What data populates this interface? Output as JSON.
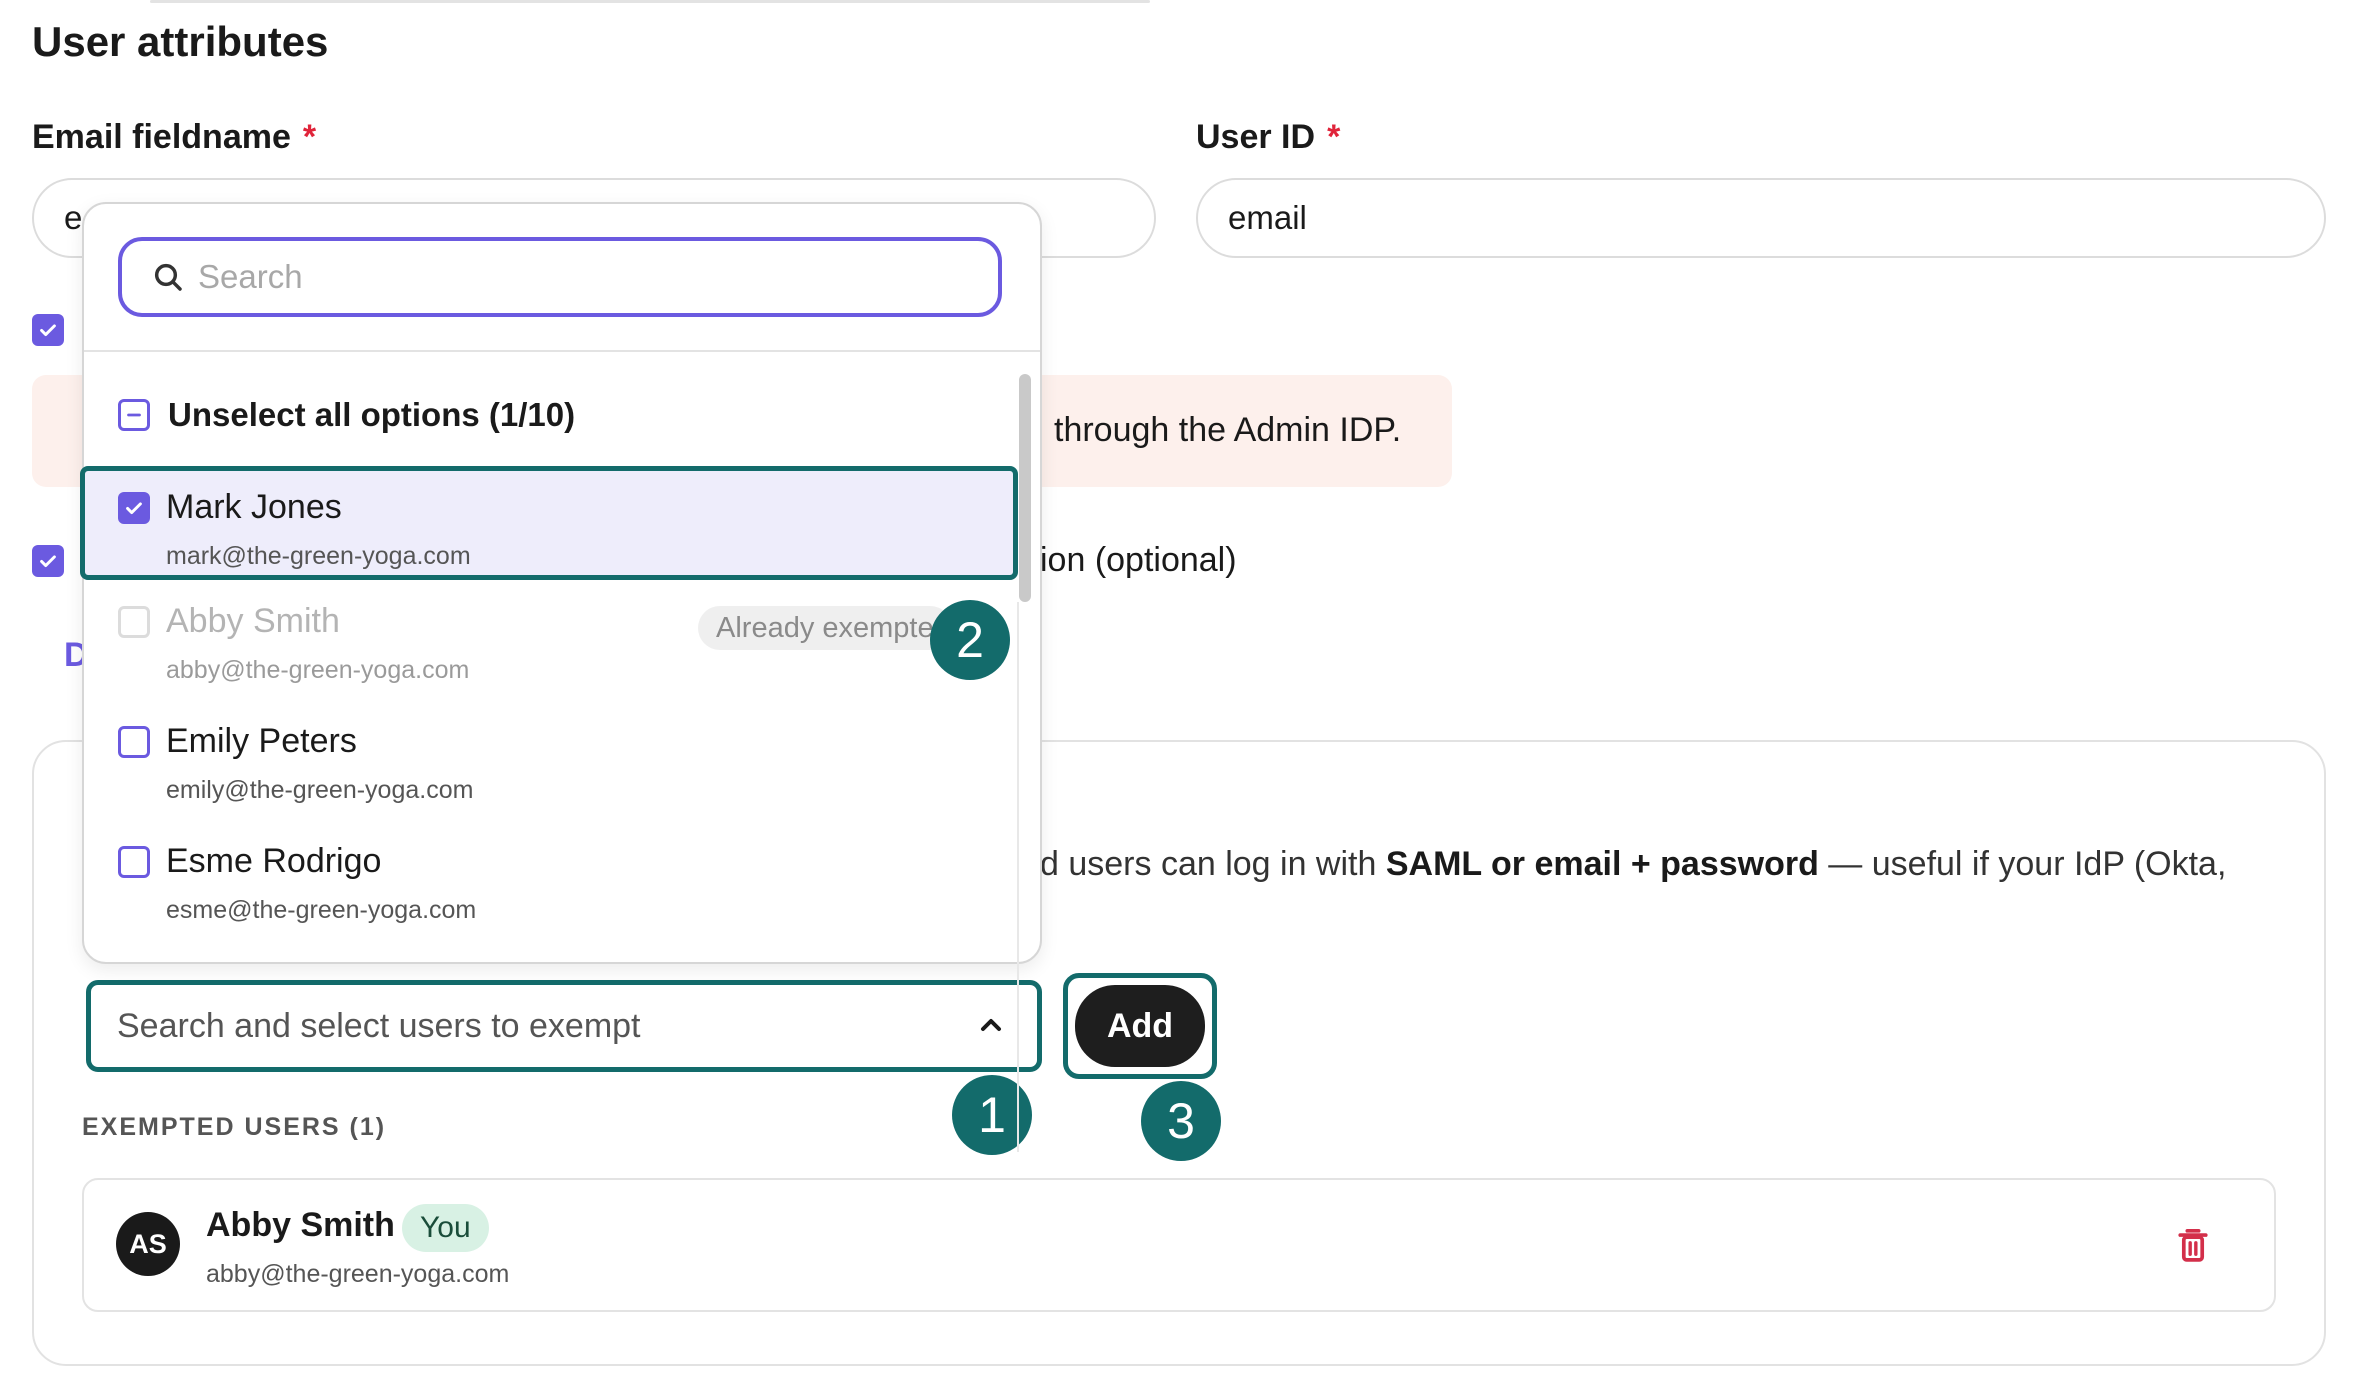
{
  "section": {
    "title": "User attributes"
  },
  "email_field": {
    "label": "Email fieldname",
    "required_mark": "*",
    "value_partial": "e"
  },
  "user_id_field": {
    "label": "User ID",
    "required_mark": "*",
    "value": "email"
  },
  "alert": {
    "text_visible": "through the Admin IDP."
  },
  "option_row": {
    "text_visible": "ion (optional)",
    "link_partial": "D"
  },
  "exemption_card": {
    "description_pre": "d users can log in with ",
    "description_bold": "SAML or email + password",
    "description_post": " — useful if your IdP (Okta,"
  },
  "dropdown": {
    "search_placeholder": "Search",
    "unselect_all_label": "Unselect all options (1/10)",
    "options": [
      {
        "name": "Mark Jones",
        "email": "mark@the-green-yoga.com",
        "checked": true,
        "disabled": false
      },
      {
        "name": "Abby Smith",
        "email": "abby@the-green-yoga.com",
        "checked": false,
        "disabled": true,
        "tag": "Already exempte"
      },
      {
        "name": "Emily Peters",
        "email": "emily@the-green-yoga.com",
        "checked": false,
        "disabled": false
      },
      {
        "name": "Esme Rodrigo",
        "email": "esme@the-green-yoga.com",
        "checked": false,
        "disabled": false
      }
    ]
  },
  "user_select": {
    "placeholder": "Search and select users to exempt"
  },
  "add_button": {
    "label": "Add"
  },
  "callouts": {
    "one": "1",
    "two": "2",
    "three": "3"
  },
  "exempted": {
    "title": "EXEMPTED USERS (1)",
    "users": [
      {
        "initials": "AS",
        "name": "Abby Smith",
        "badge": "You",
        "email": "abby@the-green-yoga.com"
      }
    ]
  },
  "colors": {
    "accent": "#6b5ae0",
    "callout_teal": "#136b6b",
    "required": "#e0243a",
    "alert_bg": "#fdf0ec",
    "delete": "#d32f4a"
  },
  "icons": {
    "search": "search-icon",
    "chevron": "chevron-up-icon",
    "delete": "trash-icon",
    "check": "check-icon"
  }
}
